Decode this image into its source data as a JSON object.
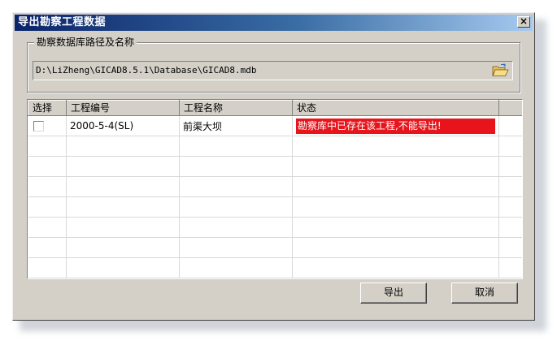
{
  "window": {
    "title": "导出勘察工程数据",
    "close_glyph": "×"
  },
  "db_group": {
    "legend": "勘察数据库路径及名称",
    "path": "D:\\LiZheng\\GICAD8.5.1\\Database\\GICAD8.mdb",
    "browse_icon": "folder-open-icon"
  },
  "grid": {
    "columns": [
      "选择",
      "工程编号",
      "工程名称",
      "状态"
    ],
    "rows": [
      {
        "checked": false,
        "code": "2000-5-4(SL)",
        "name": "前渠大坝",
        "status": "勘察库中已存在该工程,不能导出!",
        "status_color": "#e8141c"
      }
    ]
  },
  "buttons": {
    "export": "导出",
    "cancel": "取消"
  },
  "colors": {
    "titlebar_start": "#0a246a",
    "titlebar_end": "#a6caf0",
    "dialog_bg": "#d4d0c8",
    "status_error": "#e8141c"
  }
}
